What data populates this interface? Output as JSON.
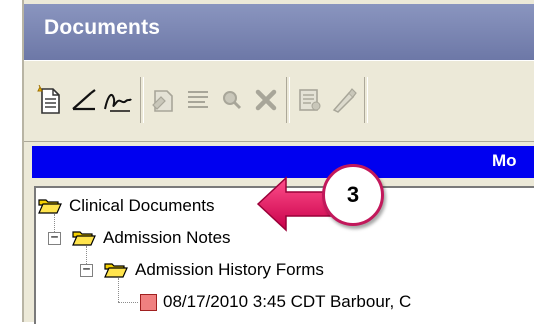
{
  "window": {
    "title": "Documents"
  },
  "banner": {
    "text": "Mo"
  },
  "toolbar": {
    "buttons": [
      {
        "icon": "new-document-icon",
        "enabled": true
      },
      {
        "icon": "sign-icon",
        "enabled": true
      },
      {
        "icon": "cosign-icon",
        "enabled": true
      },
      {
        "icon": "edit-document-icon",
        "enabled": false
      },
      {
        "icon": "list-icon",
        "enabled": false
      },
      {
        "icon": "search-icon",
        "enabled": false
      },
      {
        "icon": "delete-icon",
        "enabled": false
      },
      {
        "icon": "review-icon",
        "enabled": false
      },
      {
        "icon": "pen-icon",
        "enabled": false
      }
    ]
  },
  "tree": {
    "root": "Clinical Documents",
    "child": "Admission Notes",
    "grandchild": "Admission History Forms",
    "document": "08/17/2010 3:45 CDT Barbour, C"
  },
  "callout": {
    "number": "3",
    "color": "#e0105a"
  }
}
